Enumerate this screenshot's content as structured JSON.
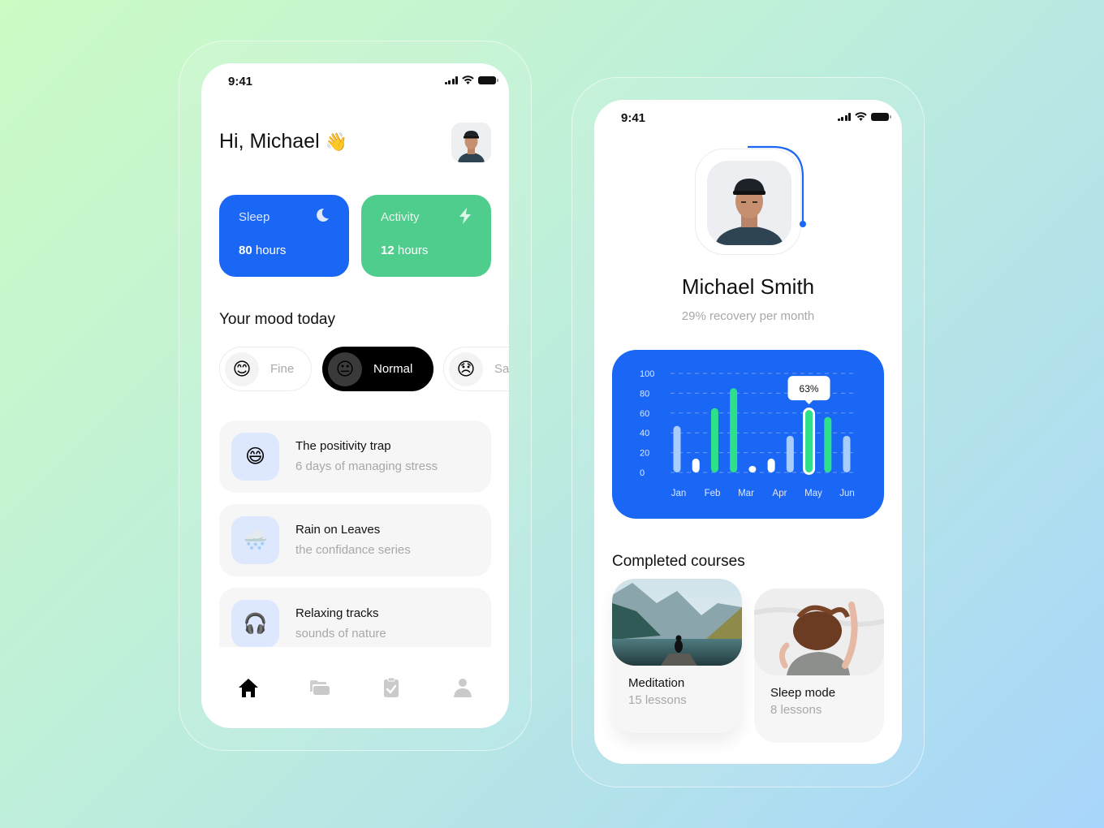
{
  "colors": {
    "primary_blue": "#1a66f5",
    "accent_green": "#4fcd8c",
    "bar_green": "#2fe08a",
    "bar_light": "#a9cdfb",
    "bar_white": "#ffffff",
    "text_dark": "#111111",
    "text_muted": "#a8a8a8"
  },
  "home_screen": {
    "status_bar": {
      "time": "9:41",
      "icons": [
        "signal-icon",
        "wifi-icon",
        "battery-icon"
      ]
    },
    "greeting": "Hi, Michael",
    "greeting_emoji": "👋",
    "avatar": "user-avatar",
    "stats": [
      {
        "label": "Sleep",
        "value": "80",
        "unit": " hours",
        "icon": "moon-icon"
      },
      {
        "label": "Activity",
        "value": "12",
        "unit": " hours",
        "icon": "lightning-icon"
      }
    ],
    "mood_title": "Your mood today",
    "moods": [
      {
        "label": "Fine",
        "emoji": "😊",
        "selected": false
      },
      {
        "label": "Normal",
        "emoji": "😐",
        "selected": true
      },
      {
        "label": "Sad",
        "emoji": "😞",
        "selected": false
      }
    ],
    "list_items": [
      {
        "title": "The positivity trap",
        "subtitle": "6 days of managing stress",
        "emoji": "😄"
      },
      {
        "title": "Rain on Leaves",
        "subtitle": "the confidance series",
        "emoji": "🌨️"
      },
      {
        "title": "Relaxing tracks",
        "subtitle": "sounds of nature",
        "emoji": "🎧"
      }
    ],
    "bottom_nav": [
      {
        "name": "home",
        "icon": "home-icon",
        "active": true
      },
      {
        "name": "folders",
        "icon": "folder-icon",
        "active": false
      },
      {
        "name": "tasks",
        "icon": "clipboard-check-icon",
        "active": false
      },
      {
        "name": "profile",
        "icon": "user-icon",
        "active": false
      }
    ]
  },
  "profile_screen": {
    "status_bar": {
      "time": "9:41",
      "icons": [
        "signal-icon",
        "wifi-icon",
        "battery-icon"
      ]
    },
    "name": "Michael Smith",
    "subtitle": "29% recovery per month",
    "courses_title": "Completed courses",
    "courses": [
      {
        "title": "Meditation",
        "lessons": "15 lessons",
        "image": "mountain-lake-photo"
      },
      {
        "title": "Sleep mode",
        "lessons": "8 lessons",
        "image": "sleeping-woman-photo"
      }
    ]
  },
  "chart_data": {
    "type": "bar",
    "title": "",
    "xlabel": "",
    "ylabel": "",
    "ylim": [
      0,
      100
    ],
    "yticks": [
      0,
      20,
      40,
      60,
      80,
      100
    ],
    "grid": true,
    "x_tick_labels": [
      "Jan",
      "Feb",
      "Mar",
      "Apr",
      "May",
      "Jun"
    ],
    "bars": [
      {
        "value": 47,
        "style": "light"
      },
      {
        "value": 14,
        "style": "white"
      },
      {
        "value": 65,
        "style": "green"
      },
      {
        "value": 85,
        "style": "green"
      },
      {
        "value": 5,
        "style": "white"
      },
      {
        "value": 14,
        "style": "white"
      },
      {
        "value": 37,
        "style": "light"
      },
      {
        "value": 63,
        "style": "green-highlight"
      },
      {
        "value": 56,
        "style": "green"
      },
      {
        "value": 37,
        "style": "light"
      }
    ],
    "tooltip": {
      "bar_index": 7,
      "label": "63%"
    }
  }
}
